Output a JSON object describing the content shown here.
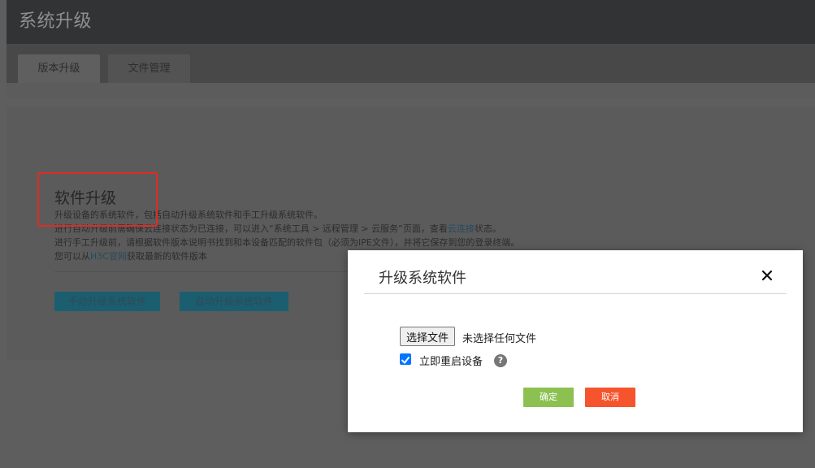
{
  "header": {
    "title": "系统升级"
  },
  "tabs": [
    {
      "label": "版本升级",
      "active": true
    },
    {
      "label": "文件管理",
      "active": false
    }
  ],
  "section": {
    "title": "软件升级",
    "lines": [
      "升级设备的系统软件，包括自动升级系统软件和手工升级系统软件。",
      {
        "before": "进行自动升级前需确保云连接状态为已连接，可以进入“系统工具 > 远程管理 > 云服务”页面，查看",
        "link": "云连接",
        "after": "状态。"
      },
      "进行手工升级前，请根据软件版本说明书找到和本设备匹配的软件包（必须为IPE文件），并将它保存到您的登录终端。",
      {
        "before": "您可以从",
        "link": "H3C官网",
        "after": "获取最新的软件版本"
      }
    ],
    "manual_button": "手动升级系统软件",
    "auto_button": "自动升级系统软件"
  },
  "modal": {
    "title": "升级系统软件",
    "close_icon": "close-icon",
    "file_button": "选择文件",
    "file_status": "未选择任何文件",
    "reboot_label": "立即重启设备",
    "reboot_checked": true,
    "help_icon": "?",
    "confirm": "确定",
    "cancel": "取消"
  },
  "colors": {
    "overlay_bg": "#5e5e5e",
    "primary_teal": "#1b5e70",
    "confirm_green": "#8cc152",
    "cancel_orange": "#f5542d",
    "highlight_red": "#e32a24",
    "checkbox_blue": "#0075ff"
  }
}
